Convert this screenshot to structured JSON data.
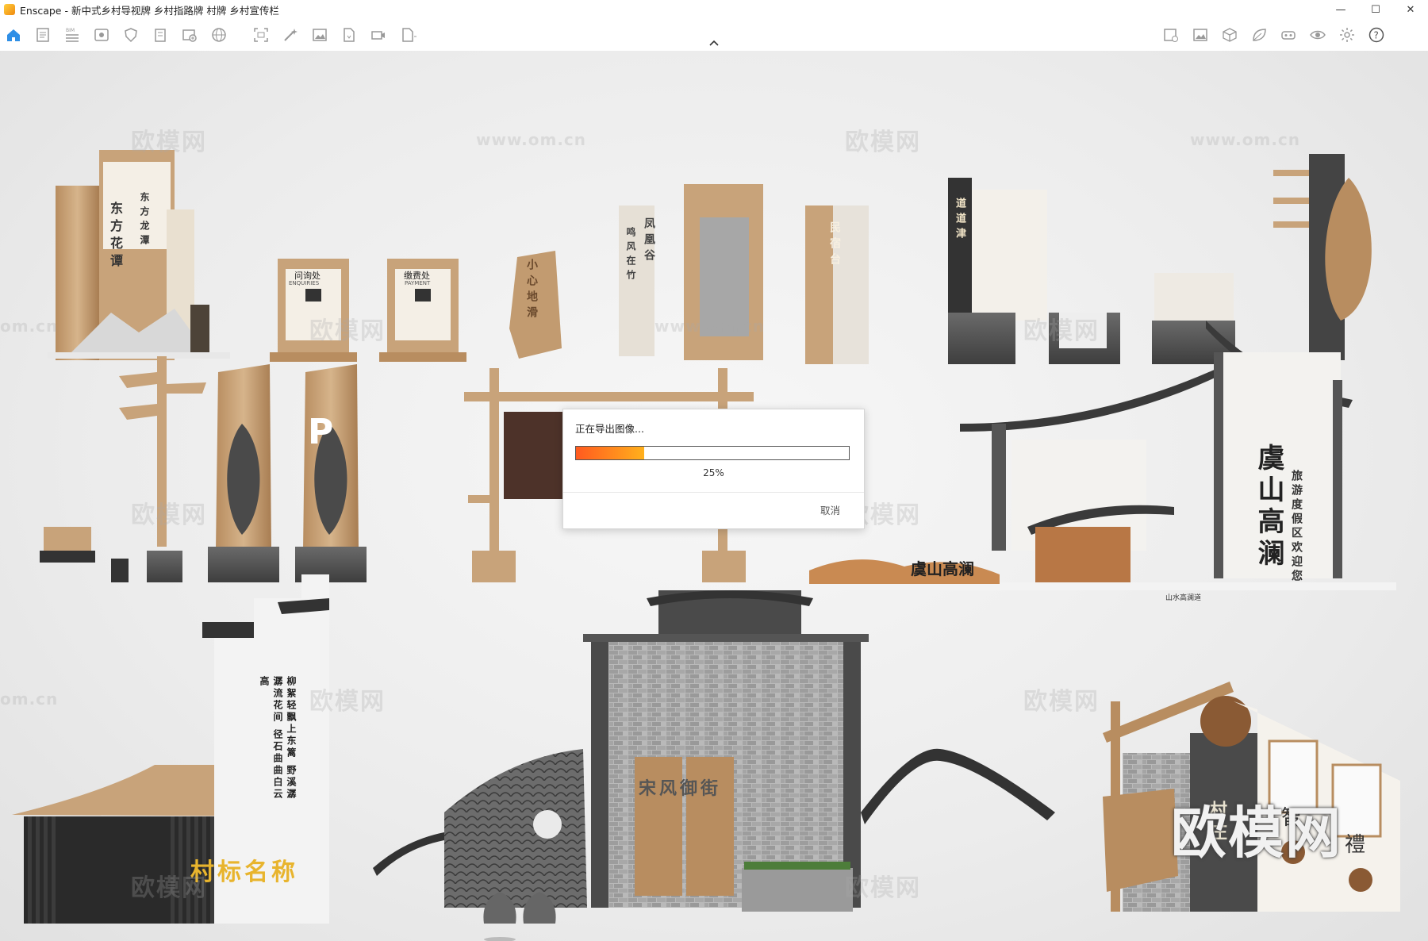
{
  "window": {
    "app_name": "Enscape",
    "title": "Enscape - 新中式乡村导视牌 乡村指路牌 村牌 乡村宣传栏",
    "controls": {
      "minimize": "—",
      "maximize": "☐",
      "close": "✕"
    }
  },
  "toolbar": {
    "left_icons": [
      "home-icon",
      "document-icon",
      "list-icon",
      "eye-view-icon",
      "shield-icon",
      "building-icon",
      "add-screenshot-icon",
      "globe-icon",
      "frame-icon",
      "magic-wand-icon",
      "image-icon",
      "file-export-icon",
      "video-icon",
      "export-icon"
    ],
    "right_icons": [
      "image-settings-icon",
      "image-icon",
      "cube-icon",
      "leaf-icon",
      "vr-headset-icon",
      "visibility-icon",
      "settings-icon",
      "help-icon"
    ],
    "bim_label": "BIM"
  },
  "viewport": {
    "watermarks": [
      "欧模网",
      "www.om.cn",
      "om.cn"
    ],
    "big_watermark": "欧模网",
    "signs": {
      "vertical_1": "东方花谭",
      "vertical_2": "东方龙潭",
      "enquiries_cn": "问询处",
      "enquiries_en": "ENQUIRIES",
      "payment_cn": "缴费处",
      "payment_en": "PAYMENT",
      "slippery": "小心地滑",
      "wind": "凤凰谷",
      "wind2": "鸣风在竹",
      "minsu": "民宿台",
      "road": "道道津",
      "parking": "P",
      "mountain": "虞山高澜",
      "mountain_small": "虞山高澜",
      "mountain_vertical": "旅游度假区欢迎您",
      "mountain_road": "山水高澜道",
      "village_name": "村标名称",
      "poem": "柳絮轻飘上东篱 野溪潺潺流花间 径石曲曲白云高",
      "alley": "宋风御街",
      "zhi": "智",
      "li": "禮",
      "village2": "村庄"
    }
  },
  "dialog": {
    "title": "正在导出图像...",
    "progress_value": 0.25,
    "progress_text": "25%",
    "cancel_label": "取消"
  },
  "colors": {
    "progress_start": "#ff5a1f",
    "progress_end": "#ffb01c",
    "wood": "#c8a37a",
    "slate": "#4a4a4a"
  }
}
